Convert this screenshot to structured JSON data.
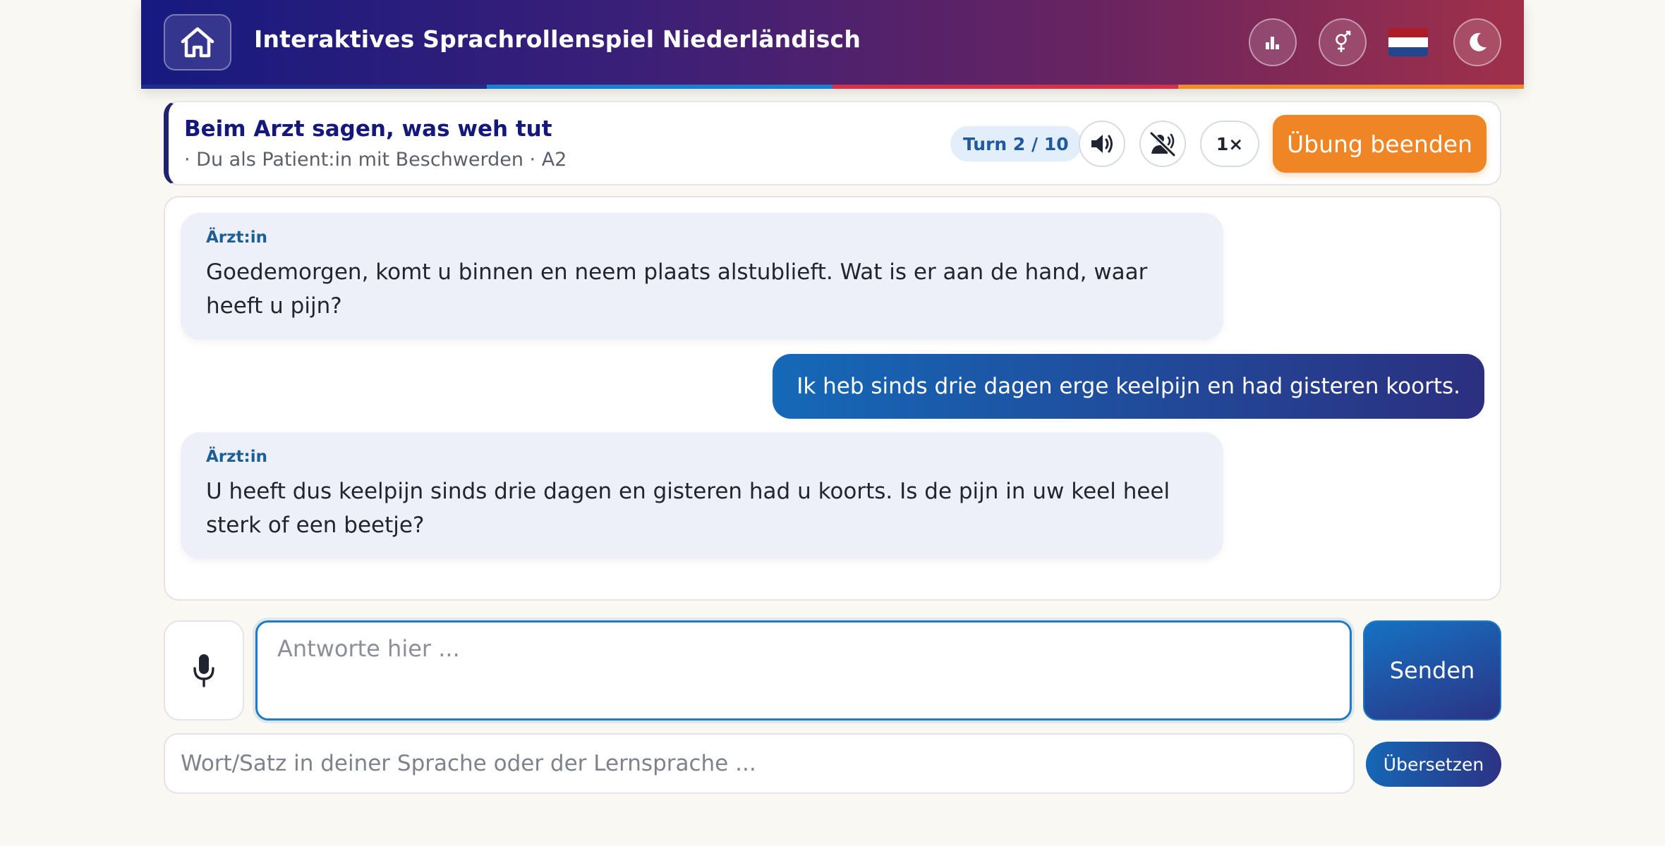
{
  "header": {
    "title": "Interaktives Sprachrollenspiel Niederländisch",
    "icons": {
      "home": "home-icon",
      "stats": "bar-chart-icon",
      "gender": "gender-icon",
      "language_flag": "netherlands-flag-icon",
      "theme": "moon-icon"
    },
    "flag_colors": [
      "#ae1c28",
      "#ffffff",
      "#21468b"
    ],
    "stripe_colors": [
      "#1f2e8a",
      "#1b7fd0",
      "#d2314a",
      "#f08a2a"
    ]
  },
  "scenario": {
    "title": "Beim Arzt sagen, was weh tut",
    "subtitle": "· Du als Patient:in mit Beschwerden · A2",
    "turn": "Turn 2 / 10",
    "speed_label": "1×",
    "end_button": "Übung beenden",
    "icons": {
      "audio": "speaker-icon",
      "mute": "voice-off-icon"
    }
  },
  "chat": {
    "messages": [
      {
        "role": "bot",
        "speaker": "Ärzt:in",
        "text": "Goedemorgen, komt u binnen en neem plaats alstublieft. Wat is er aan de hand, waar heeft u pijn?"
      },
      {
        "role": "user",
        "text": "Ik heb sinds drie dagen erge keelpijn en had gisteren koorts."
      },
      {
        "role": "bot",
        "speaker": "Ärzt:in",
        "text": "U heeft dus keelpijn sinds drie dagen en gisteren had u koorts. Is de pijn in uw keel heel sterk of een beetje?"
      }
    ]
  },
  "composer": {
    "placeholder": "Antworte hier ...",
    "value": "",
    "send_label": "Senden",
    "mic_icon": "microphone-icon"
  },
  "translator": {
    "placeholder": "Wort/Satz in deiner Sprache oder der Lernsprache ...",
    "value": "",
    "button_label": "Übersetzen"
  },
  "colors": {
    "accent_orange": "#ef8524",
    "primary_blue": "#1672c3",
    "navy": "#14187a"
  }
}
